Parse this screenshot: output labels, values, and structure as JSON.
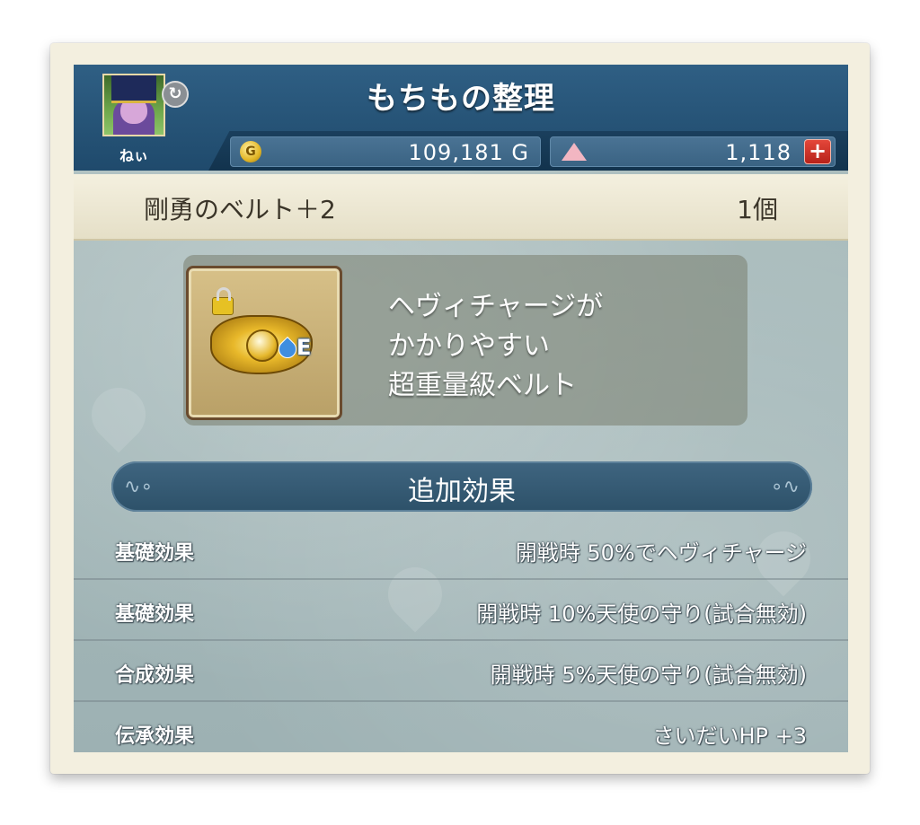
{
  "header": {
    "title": "もちもの整理",
    "player_name": "ねぃ",
    "gold_symbol": "G",
    "gold": "109,181 G",
    "gems": "1,118",
    "add_gems_symbol": "+"
  },
  "item": {
    "name": "剛勇のベルト＋2",
    "count": "1個",
    "equip_letter": "E",
    "description": [
      "ヘヴィチャージが",
      "かかりやすい",
      "超重量級ベルト"
    ]
  },
  "section": {
    "title": "追加効果"
  },
  "effects": [
    {
      "label": "基礎効果",
      "value": "開戦時 50%でヘヴィチャージ"
    },
    {
      "label": "基礎効果",
      "value": "開戦時 10%天使の守り(試合無効)"
    },
    {
      "label": "合成効果",
      "value": "開戦時 5%天使の守り(試合無効)"
    },
    {
      "label": "伝承効果",
      "value": "さいだいHP +3"
    }
  ],
  "colors": {
    "header_bg": "#1f4a6c",
    "accent_red": "#c8261c",
    "gold": "#e2b626"
  }
}
